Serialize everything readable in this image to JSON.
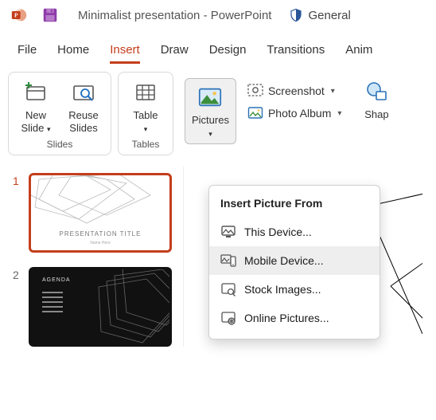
{
  "titlebar": {
    "doc_name": "Minimalist presentation",
    "app_name": "PowerPoint",
    "separator": "  -  ",
    "sensitivity_label": "General"
  },
  "tabs": {
    "file": "File",
    "home": "Home",
    "insert": "Insert",
    "draw": "Draw",
    "design": "Design",
    "transitions": "Transitions",
    "animations": "Anim"
  },
  "ribbon": {
    "new_slide": "New\nSlide",
    "reuse_slides": "Reuse\nSlides",
    "slides_caption": "Slides",
    "table": "Table",
    "tables_caption": "Tables",
    "pictures": "Pictures",
    "screenshot": "Screenshot",
    "photo_album": "Photo Album",
    "shapes": "Shap"
  },
  "dropdown": {
    "header": "Insert Picture From",
    "this_device": "This Device...",
    "mobile_device": "Mobile Device...",
    "stock_images": "Stock Images...",
    "online_pictures": "Online Pictures..."
  },
  "thumbs": {
    "n1": "1",
    "n2": "2",
    "slide1_title": "PRESENTATION TITLE",
    "slide1_sub": "Name Here",
    "slide2_label": "AGENDA"
  }
}
